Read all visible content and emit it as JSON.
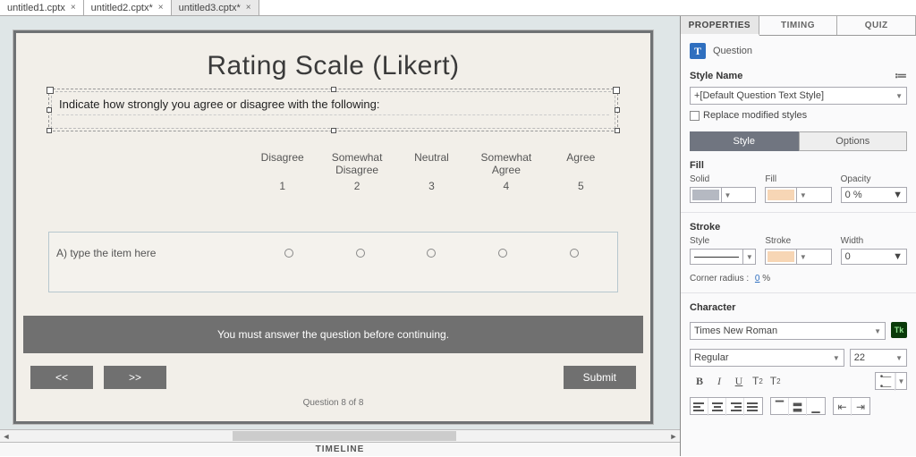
{
  "tabs": [
    {
      "label": "untitled1.cptx"
    },
    {
      "label": "untitled2.cptx*"
    },
    {
      "label": "untitled3.cptx*"
    }
  ],
  "slide": {
    "title": "Rating Scale (Likert)",
    "prompt": "Indicate how strongly you agree or disagree with the following:",
    "headers": [
      "Disagree",
      "Somewhat Disagree",
      "Neutral",
      "Somewhat Agree",
      "Agree"
    ],
    "nums": [
      "1",
      "2",
      "3",
      "4",
      "5"
    ],
    "item_label": "A) type the item here",
    "warn": "You must answer the question before continuing.",
    "prev": "<<",
    "next": ">>",
    "submit": "Submit",
    "counter": "Question 8 of 8"
  },
  "timeline_label": "TIMELINE",
  "panel": {
    "tabs": {
      "properties": "PROPERTIES",
      "timing": "TIMING",
      "quiz": "QUIZ"
    },
    "object_type": "Question",
    "style_name_label": "Style Name",
    "style_name_value": "+[Default Question Text Style]",
    "replace_styles": "Replace modified styles",
    "subtabs": {
      "style": "Style",
      "options": "Options"
    },
    "fill": {
      "section": "Fill",
      "solid": "Solid",
      "fill": "Fill",
      "opacity": "Opacity",
      "opacity_val": "0 %"
    },
    "stroke": {
      "section": "Stroke",
      "style": "Style",
      "stroke": "Stroke",
      "width": "Width",
      "width_val": "0"
    },
    "corner": {
      "label": "Corner radius :",
      "value": "0",
      "unit": "%"
    },
    "character": {
      "section": "Character",
      "font": "Times New Roman",
      "weight": "Regular",
      "size": "22"
    },
    "format": {
      "b": "B",
      "i": "I",
      "u": "U",
      "sup": "T",
      "sub": "T"
    },
    "tk": "Tk"
  }
}
